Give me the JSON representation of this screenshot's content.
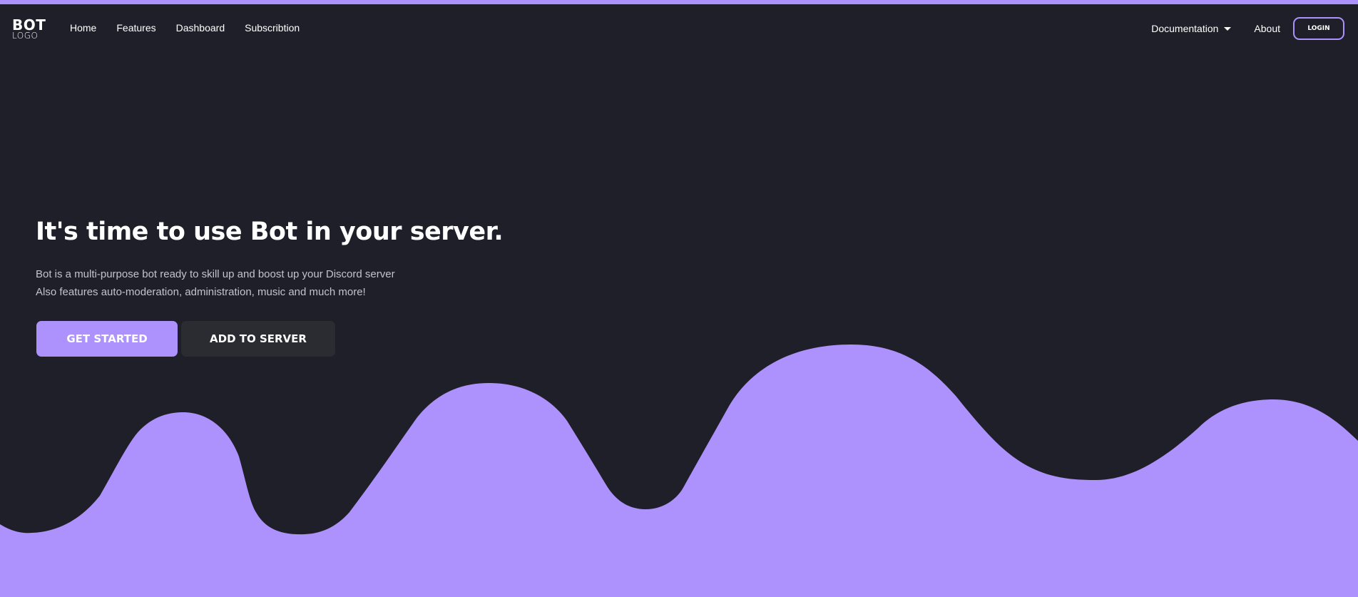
{
  "brand": {
    "logo_main": "BOT",
    "logo_sub": "LOGO",
    "accent_color": "#ad91fd",
    "background_color": "#1e1f28"
  },
  "nav": {
    "left_items": [
      {
        "label": "Home"
      },
      {
        "label": "Features"
      },
      {
        "label": "Dashboard"
      },
      {
        "label": "Subscribtion"
      }
    ],
    "documentation_label": "Documentation",
    "about_label": "About",
    "login_label": "LOGIN"
  },
  "hero": {
    "title": "It's time to use Bot in your server.",
    "description_line1": "Bot is a multi-purpose bot ready to skill up and boost up your Discord server",
    "description_line2": "Also features auto-moderation, administration, music and much more!",
    "primary_button": "GET STARTED",
    "secondary_button": "ADD TO SERVER"
  },
  "icons": {
    "dropdown": "caret-down-icon"
  }
}
